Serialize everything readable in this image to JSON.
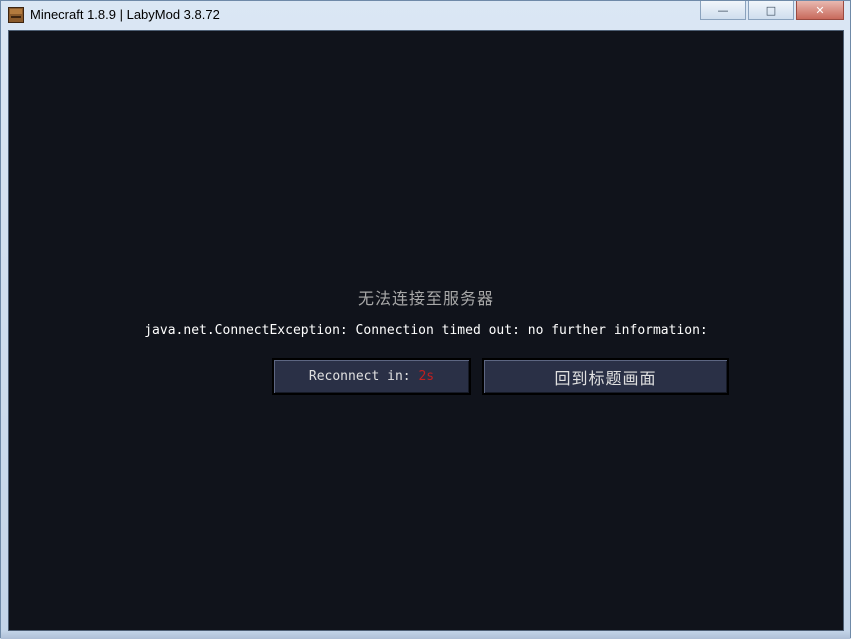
{
  "window": {
    "title": "Minecraft 1.8.9 | LabyMod 3.8.72",
    "app_icon": "minecraft-crafting-table-icon",
    "controls": {
      "minimize_icon": "minimize-icon",
      "maximize_icon": "maximize-icon",
      "close_icon": "close-icon"
    }
  },
  "screen": {
    "background_color": "#10131b",
    "heading": "无法连接至服务器",
    "message": "java.net.ConnectException: Connection timed out: no further information:",
    "buttons": {
      "reconnect_label": "Reconnect in: ",
      "reconnect_countdown": "2s",
      "countdown_color": "#c31f1f",
      "title_screen_label": "回到标题画面"
    }
  }
}
